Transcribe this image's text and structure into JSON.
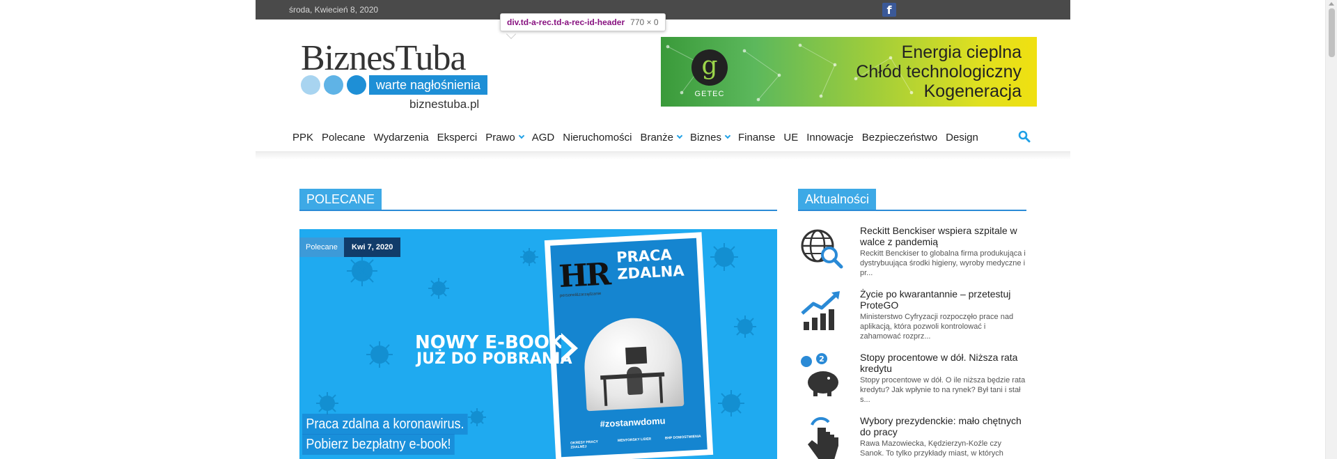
{
  "topbar": {
    "date": "środa, Kwiecień 8, 2020",
    "social_icon": "facebook-icon"
  },
  "devtools_tooltip": {
    "selector": "div.td-a-rec.td-a-rec-id-header",
    "size": "770 × 0"
  },
  "logo": {
    "name": "BiznesTuba",
    "slogan": "warte nagłośnienia",
    "domain": "biznestuba.pl"
  },
  "ad": {
    "brand": "GETEC",
    "logo_letter": "g",
    "lines": [
      "Energia cieplna",
      "Chłód technologiczny",
      "Kogeneracja"
    ]
  },
  "nav": {
    "items": [
      {
        "label": "PPK",
        "dropdown": false
      },
      {
        "label": "Polecane",
        "dropdown": false
      },
      {
        "label": "Wydarzenia",
        "dropdown": false
      },
      {
        "label": "Eksperci",
        "dropdown": false
      },
      {
        "label": "Prawo",
        "dropdown": true
      },
      {
        "label": "AGD",
        "dropdown": false
      },
      {
        "label": "Nieruchomości",
        "dropdown": false
      },
      {
        "label": "Branże",
        "dropdown": true
      },
      {
        "label": "Biznes",
        "dropdown": true
      },
      {
        "label": "Finanse",
        "dropdown": false
      },
      {
        "label": "UE",
        "dropdown": false
      },
      {
        "label": "Innowacje",
        "dropdown": false
      },
      {
        "label": "Bezpieczeństwo",
        "dropdown": false
      },
      {
        "label": "Design",
        "dropdown": false
      }
    ],
    "search_icon": "search-icon"
  },
  "sections": {
    "main": "POLECANE",
    "sidebar": "Aktualności"
  },
  "featured": {
    "category": "Polecane",
    "date": "Kwi 7, 2020",
    "title_lines": [
      "Praca zdalna a koronawirus.",
      "Pobierz bezpłatny e-book!"
    ],
    "banner_line_1": "NOWY E-BOOK",
    "banner_line_2": "JUŻ DO POBRANIA",
    "cover": {
      "logo": "HR",
      "logo_sub": "personel&zarządzanie",
      "title_1": "PRACA",
      "title_2": "ZDALNA",
      "hashtag": "#zostanwdomu",
      "col_1": "OKRESY PRACY ZDALNEJ",
      "col_2": "MENTORSKY LIDER",
      "col_3": "BHP DOMOSTWIENIA"
    }
  },
  "news": [
    {
      "title": "Reckitt Benckiser wspiera szpitale w walce z pandemią",
      "excerpt": "Reckitt Benckiser to globalna firma produkująca i dystrybuująca środki higieny, wyroby medyczne i pr...",
      "icon": "globe-search-icon"
    },
    {
      "title": "Życie po kwarantannie – przetestuj ProteGO",
      "excerpt": "Ministerstwo Cyfryzacji rozpoczęło prace nad aplikacją, która pozwoli kontrolować i zahamować rozprz...",
      "icon": "growth-chart-icon"
    },
    {
      "title": "Stopy procentowe w dół. Niższa rata kredytu",
      "excerpt": "Stopy procentowe w dół. O ile niższa będzie rata kredytu? Jak wpłynie to na rynek? Był tani i stał s...",
      "icon": "piggy-bank-icon"
    },
    {
      "title": "Wybory prezydenckie: mało chętnych do pracy",
      "excerpt": "Rawa Mazowiecka, Kędzierzyn-Koźle czy Sanok. To tylko przykłady miast, w których",
      "icon": "hand-pointer-icon"
    }
  ],
  "colors": {
    "accent": "#3da9e6",
    "topbar": "#4a4a4a",
    "featured_bg": "#1faaf0"
  }
}
